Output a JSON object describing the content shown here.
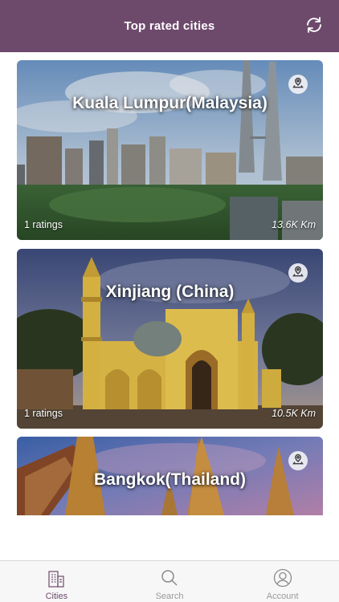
{
  "header": {
    "title": "Top rated cities",
    "refresh_icon": "refresh-icon"
  },
  "cities": [
    {
      "name": "Kuala Lumpur(Malaysia)",
      "ratings": "1 ratings",
      "distance": "13.6K Km",
      "map_icon": "map-pin-icon"
    },
    {
      "name": "Xinjiang (China)",
      "ratings": "1 ratings",
      "distance": "10.5K Km",
      "map_icon": "map-pin-icon"
    },
    {
      "name": "Bangkok(Thailand)",
      "map_icon": "map-pin-icon"
    }
  ],
  "tabbar": {
    "tabs": [
      {
        "label": "Cities",
        "icon": "city-buildings-icon",
        "active": true
      },
      {
        "label": "Search",
        "icon": "search-icon",
        "active": false
      },
      {
        "label": "Account",
        "icon": "account-icon",
        "active": false
      }
    ]
  },
  "colors": {
    "header": "#6d4a6b",
    "active_tab": "#6d4a6b",
    "inactive_tab": "#9a9a9a"
  }
}
